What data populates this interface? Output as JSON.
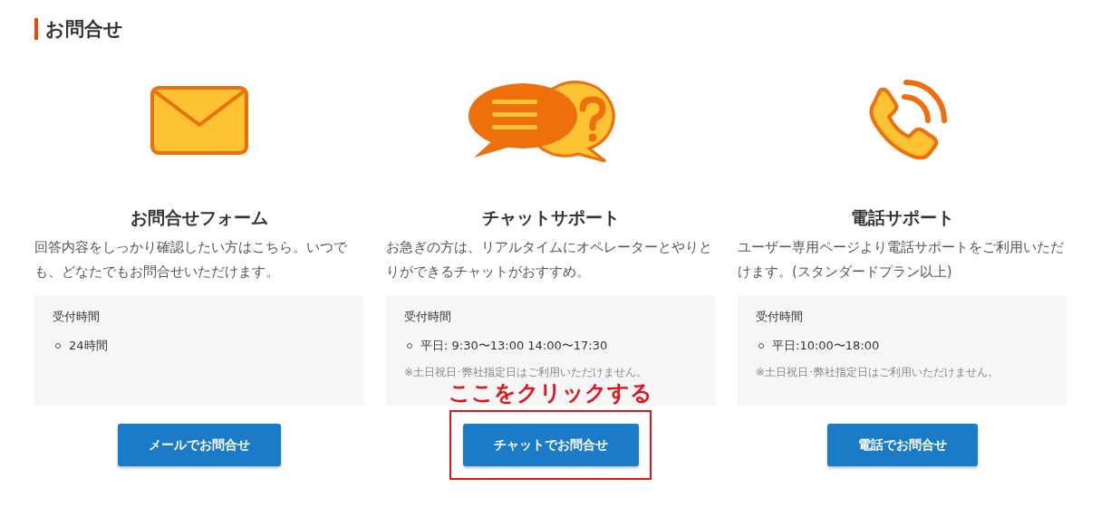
{
  "section_title": "お問合せ",
  "cards": [
    {
      "title": "お問合せフォーム",
      "description": "回答内容をしっかり確認したい方はこちら。いつでも、どなたでもお問合せいただけます。",
      "hours_label": "受付時間",
      "hours": [
        "24時間"
      ],
      "button": "メールでお問合せ",
      "highlighted": false
    },
    {
      "title": "チャットサポート",
      "description": "お急ぎの方は、リアルタイムにオペレーターとやりとりができるチャットがおすすめ。",
      "hours_label": "受付時間",
      "hours": [
        "平日: 9:30〜13:00 14:00〜17:30"
      ],
      "note": "※土日祝日･弊社指定日はご利用いただけません。",
      "button": "チャットでお問合せ",
      "highlighted": true
    },
    {
      "title": "電話サポート",
      "description": "ユーザー専用ページより電話サポートをご利用いただけます。(スタンダードプラン以上)",
      "hours_label": "受付時間",
      "hours": [
        "平日:10:00〜18:00"
      ],
      "note": "※土日祝日･弊社指定日はご利用いただけません。",
      "button": "電話でお問合せ",
      "highlighted": false
    }
  ],
  "annotation": {
    "text": "ここをクリックする"
  }
}
